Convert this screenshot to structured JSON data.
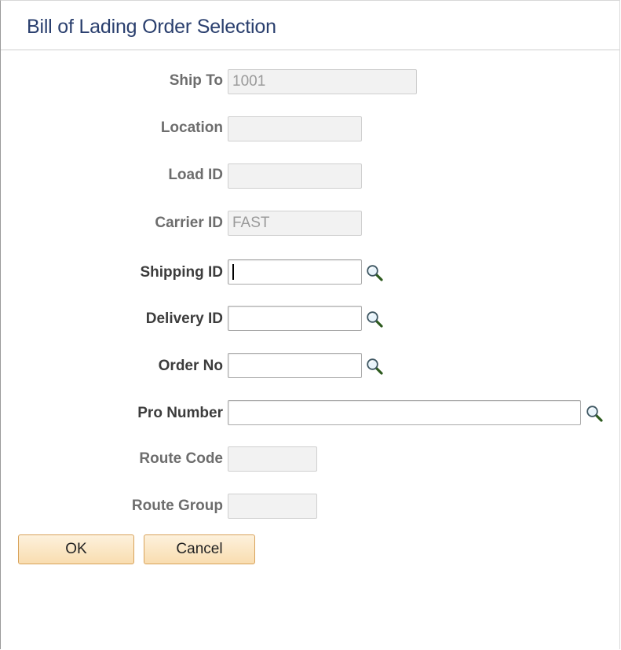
{
  "page": {
    "title": "Bill of Lading Order Selection"
  },
  "fields": {
    "ship_to": {
      "label": "Ship To",
      "value": "1001"
    },
    "location": {
      "label": "Location",
      "value": ""
    },
    "load_id": {
      "label": "Load ID",
      "value": ""
    },
    "carrier_id": {
      "label": "Carrier ID",
      "value": "FAST"
    },
    "shipping_id": {
      "label": "Shipping ID",
      "value": ""
    },
    "delivery_id": {
      "label": "Delivery ID",
      "value": ""
    },
    "order_no": {
      "label": "Order No",
      "value": ""
    },
    "pro_number": {
      "label": "Pro Number",
      "value": ""
    },
    "route_code": {
      "label": "Route Code",
      "value": ""
    },
    "route_group": {
      "label": "Route Group",
      "value": ""
    }
  },
  "buttons": {
    "ok": "OK",
    "cancel": "Cancel"
  },
  "icons": {
    "lookup": "magnifier-icon"
  }
}
